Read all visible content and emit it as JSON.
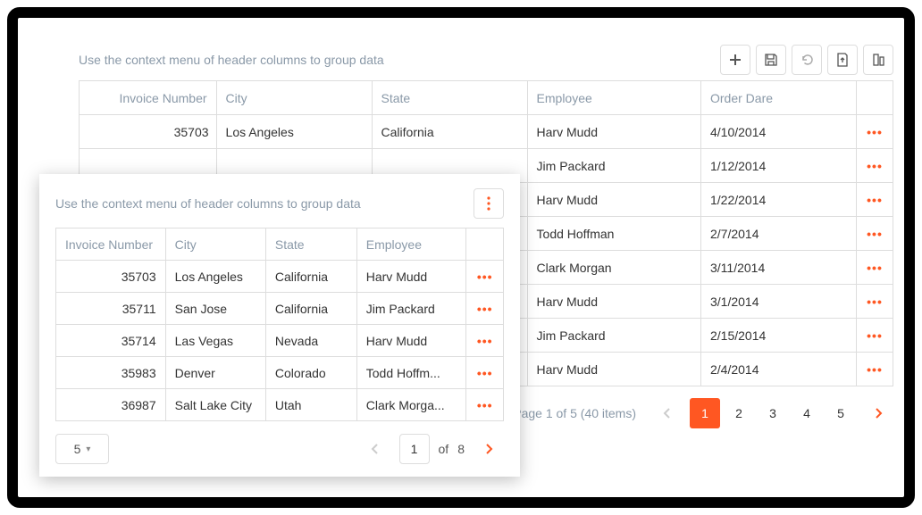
{
  "instruction": "Use the context menu of header columns to group data",
  "back": {
    "columns": [
      "Invoice Number",
      "City",
      "State",
      "Employee",
      "Order Dare"
    ],
    "rows": [
      {
        "inv": "35703",
        "city": "Los Angeles",
        "state": "California",
        "emp": "Harv Mudd",
        "date": "4/10/2014"
      },
      {
        "inv": "",
        "city": "",
        "state": "",
        "emp": "Jim Packard",
        "date": "1/12/2014"
      },
      {
        "inv": "",
        "city": "",
        "state": "",
        "emp": "Harv Mudd",
        "date": "1/22/2014"
      },
      {
        "inv": "",
        "city": "",
        "state": "",
        "emp": "Todd Hoffman",
        "date": "2/7/2014"
      },
      {
        "inv": "",
        "city": "",
        "state": "",
        "emp": "Clark Morgan",
        "date": "3/11/2014"
      },
      {
        "inv": "",
        "city": "",
        "state": "",
        "emp": "Harv Mudd",
        "date": "3/1/2014"
      },
      {
        "inv": "",
        "city": "",
        "state": "",
        "emp": "Jim Packard",
        "date": "2/15/2014"
      },
      {
        "inv": "",
        "city": "",
        "state": "",
        "emp": "Harv Mudd",
        "date": "2/4/2014"
      }
    ],
    "pager": {
      "text": "Page 1 of 5 (40 items)",
      "pages": [
        "1",
        "2",
        "3",
        "4",
        "5"
      ],
      "active": 1
    }
  },
  "front": {
    "columns": [
      "Invoice Number",
      "City",
      "State",
      "Employee"
    ],
    "rows": [
      {
        "inv": "35703",
        "city": "Los Angeles",
        "state": "California",
        "emp": "Harv Mudd"
      },
      {
        "inv": "35711",
        "city": "San Jose",
        "state": "California",
        "emp": "Jim Packard"
      },
      {
        "inv": "35714",
        "city": "Las Vegas",
        "state": "Nevada",
        "emp": "Harv Mudd"
      },
      {
        "inv": "35983",
        "city": "Denver",
        "state": "Colorado",
        "emp": "Todd Hoffm..."
      },
      {
        "inv": "36987",
        "city": "Salt Lake City",
        "state": "Utah",
        "emp": "Clark Morga..."
      }
    ],
    "pager": {
      "pagesize": "5",
      "page": "1",
      "of": "of",
      "total": "8"
    }
  }
}
